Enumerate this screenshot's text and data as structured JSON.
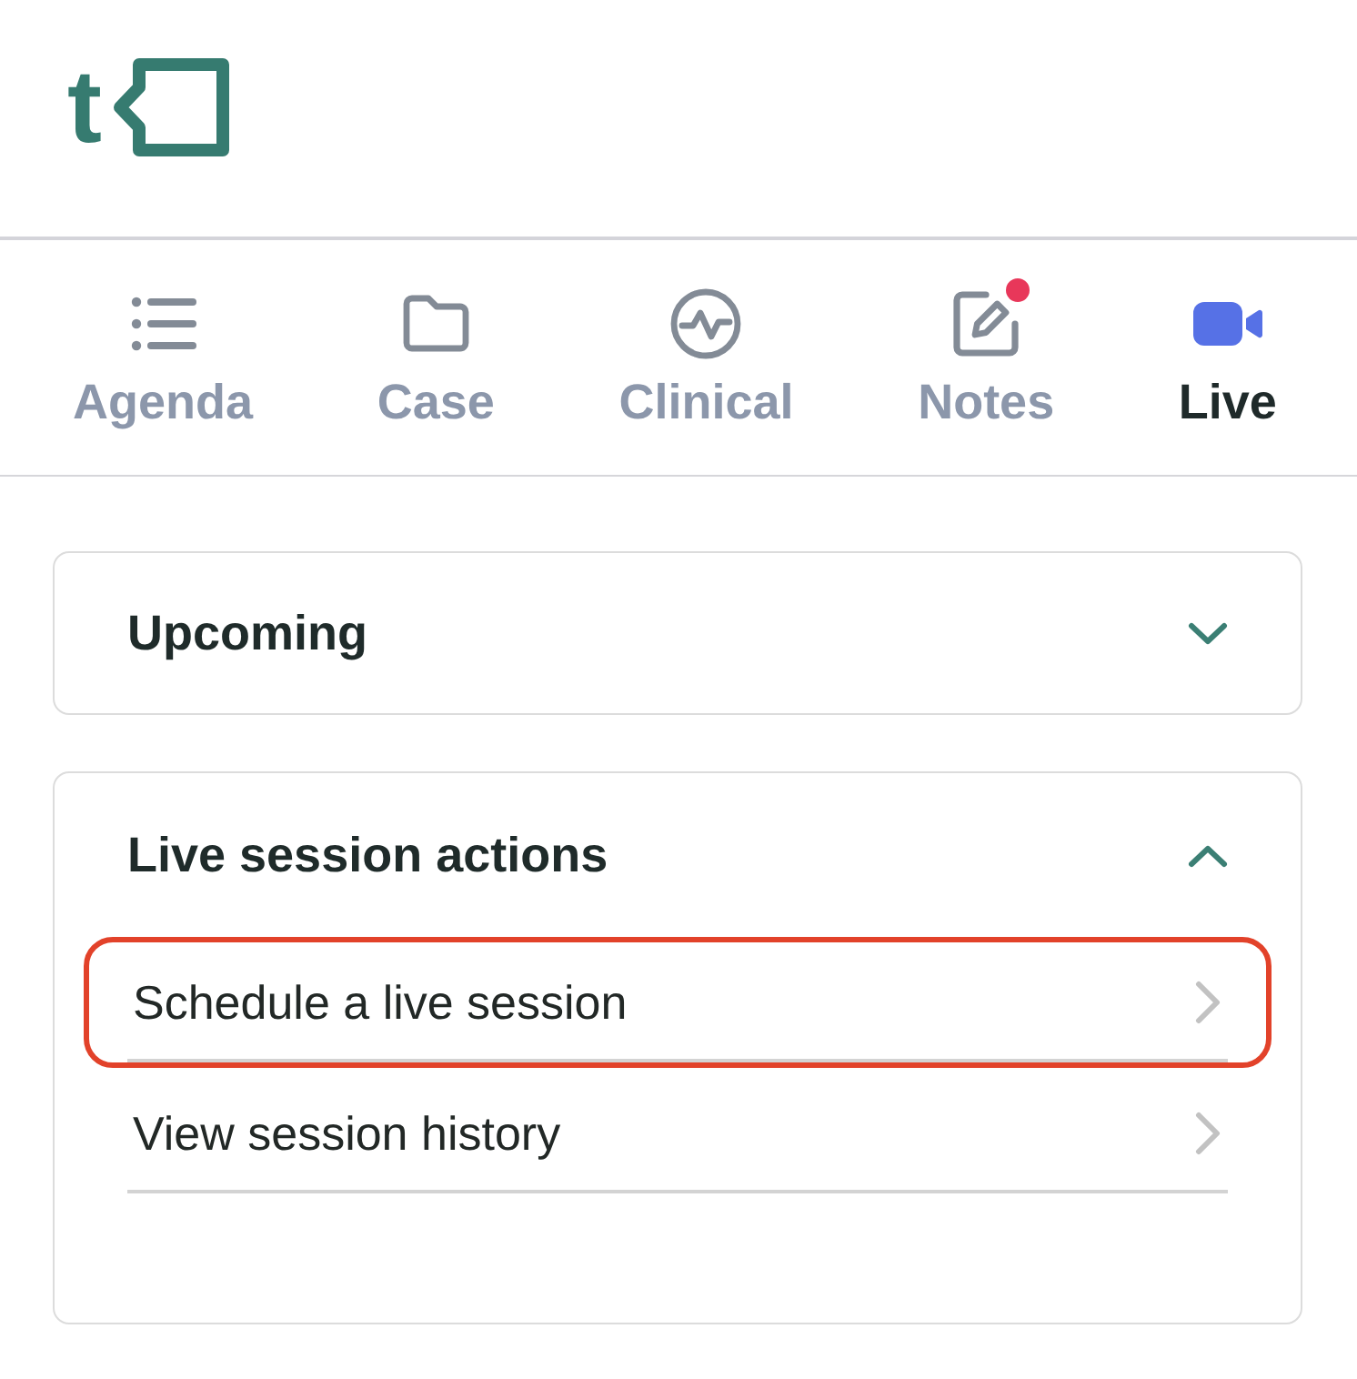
{
  "logo": {
    "text": "t"
  },
  "tabs": [
    {
      "label": "Agenda",
      "kind": "agenda",
      "selected": false,
      "notification": false
    },
    {
      "label": "Case",
      "kind": "case",
      "selected": false,
      "notification": false
    },
    {
      "label": "Clinical",
      "kind": "clinical",
      "selected": false,
      "notification": false
    },
    {
      "label": "Notes",
      "kind": "notes",
      "selected": false,
      "notification": true
    },
    {
      "label": "Live",
      "kind": "live",
      "selected": true,
      "notification": false
    }
  ],
  "sections": [
    {
      "title": "Upcoming",
      "expanded": false
    },
    {
      "title": "Live session actions",
      "expanded": true,
      "actions": [
        {
          "label": "Schedule a live session",
          "highlighted": true
        },
        {
          "label": "View session history",
          "highlighted": false
        }
      ]
    }
  ]
}
